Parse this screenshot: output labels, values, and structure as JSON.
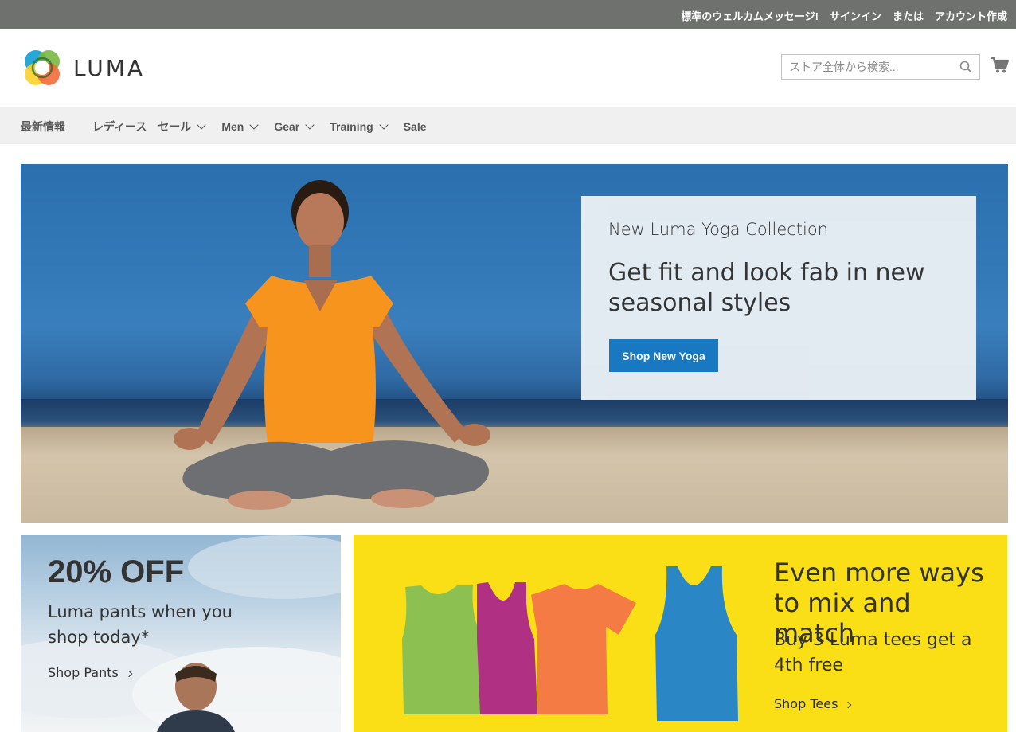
{
  "topbar": {
    "welcome": "標準のウェルカムメッセージ!",
    "sign_in": "サインイン",
    "or": "または",
    "create_account": "アカウント作成"
  },
  "header": {
    "logo_text": "LUMA",
    "search_placeholder": "ストア全体から検索...",
    "search_icon": "search-icon",
    "cart_icon": "cart-icon"
  },
  "nav": {
    "items": [
      {
        "label": "最新情報",
        "has_dropdown": false
      },
      {
        "label": "レディース",
        "has_dropdown": false
      },
      {
        "label": "セール",
        "has_dropdown": true
      },
      {
        "label": "Men",
        "has_dropdown": true
      },
      {
        "label": "Gear",
        "has_dropdown": true
      },
      {
        "label": "Training",
        "has_dropdown": true
      },
      {
        "label": "Sale",
        "has_dropdown": false
      }
    ]
  },
  "hero": {
    "subtitle": "New Luma Yoga Collection",
    "headline": "Get fit and look fab in new seasonal styles",
    "button": "Shop New Yoga"
  },
  "promo_pants": {
    "title": "20% OFF",
    "text": "Luma pants when you shop today*",
    "link": "Shop Pants"
  },
  "promo_tees": {
    "title": "Even more ways to mix and match",
    "text": "Buy 3 Luma tees get a 4th free",
    "link": "Shop Tees",
    "shirt_colors": [
      "#8cc152",
      "#b03084",
      "#f47c44",
      "#2b86c6"
    ]
  },
  "colors": {
    "topbar_bg": "#6e716e",
    "nav_bg": "#f0f0f0",
    "primary_button": "#1979c3",
    "promo_yellow": "#fbdf16"
  }
}
